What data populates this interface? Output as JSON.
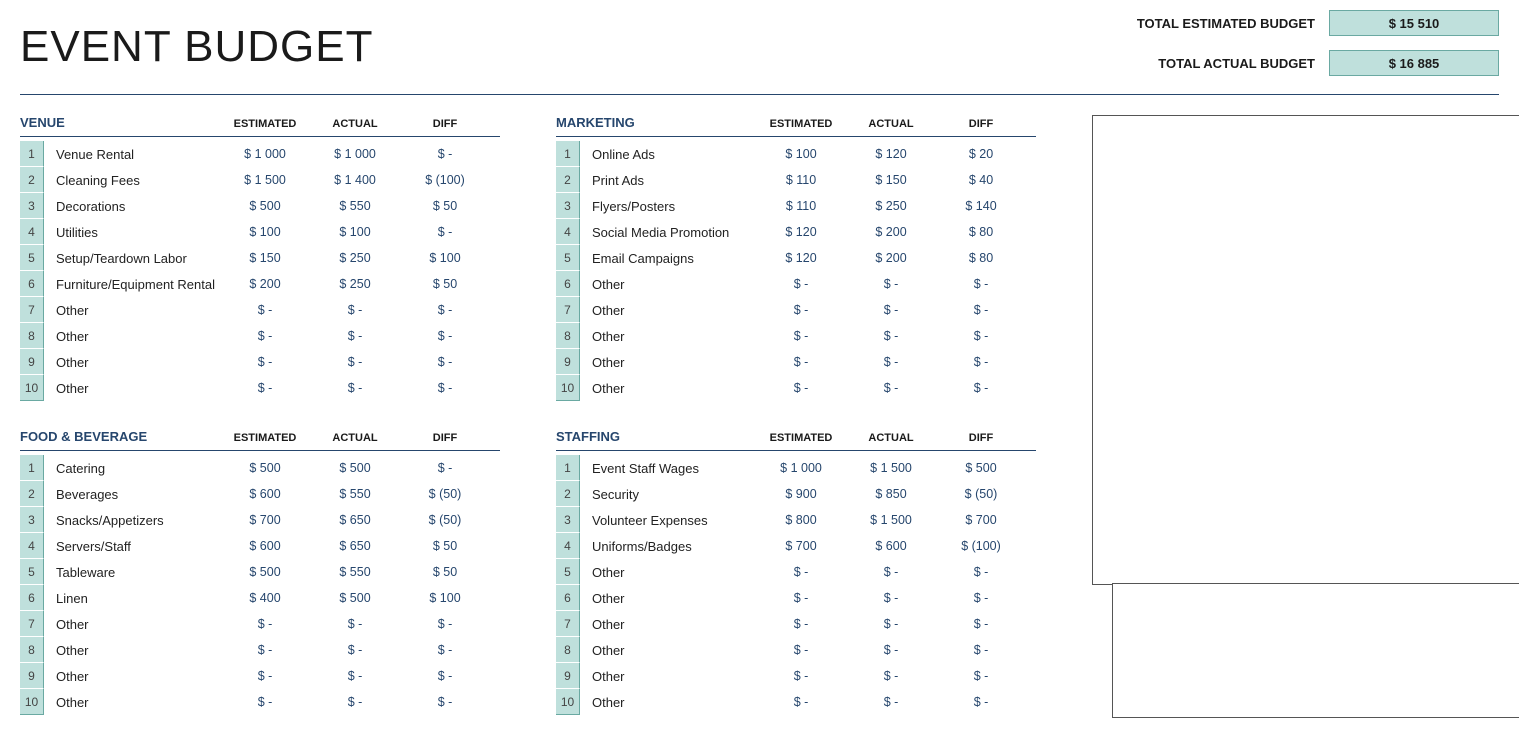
{
  "title": "EVENT BUDGET",
  "totals": {
    "estimated_label": "TOTAL ESTIMATED BUDGET",
    "estimated_value": "$ 15 510",
    "actual_label": "TOTAL ACTUAL BUDGET",
    "actual_value": "$ 16 885"
  },
  "columns": {
    "est": "ESTIMATED",
    "act": "ACTUAL",
    "diff": "DIFF"
  },
  "sections": [
    {
      "title": "VENUE",
      "rows": [
        {
          "n": "1",
          "label": "Venue Rental",
          "est": "$ 1 000",
          "act": "$ 1 000",
          "diff": "$ -"
        },
        {
          "n": "2",
          "label": "Cleaning Fees",
          "est": "$ 1 500",
          "act": "$ 1 400",
          "diff": "$ (100)"
        },
        {
          "n": "3",
          "label": "Decorations",
          "est": "$ 500",
          "act": "$ 550",
          "diff": "$ 50"
        },
        {
          "n": "4",
          "label": "Utilities",
          "est": "$ 100",
          "act": "$ 100",
          "diff": "$ -"
        },
        {
          "n": "5",
          "label": "Setup/Teardown Labor",
          "est": "$ 150",
          "act": "$ 250",
          "diff": "$ 100"
        },
        {
          "n": "6",
          "label": "Furniture/Equipment Rental",
          "est": "$ 200",
          "act": "$ 250",
          "diff": "$ 50"
        },
        {
          "n": "7",
          "label": "Other",
          "est": "$ -",
          "act": "$ -",
          "diff": "$ -"
        },
        {
          "n": "8",
          "label": "Other",
          "est": "$ -",
          "act": "$ -",
          "diff": "$ -"
        },
        {
          "n": "9",
          "label": "Other",
          "est": "$ -",
          "act": "$ -",
          "diff": "$ -"
        },
        {
          "n": "10",
          "label": "Other",
          "est": "$ -",
          "act": "$ -",
          "diff": "$ -"
        }
      ]
    },
    {
      "title": "MARKETING",
      "rows": [
        {
          "n": "1",
          "label": "Online Ads",
          "est": "$ 100",
          "act": "$ 120",
          "diff": "$ 20"
        },
        {
          "n": "2",
          "label": "Print Ads",
          "est": "$ 110",
          "act": "$ 150",
          "diff": "$ 40"
        },
        {
          "n": "3",
          "label": "Flyers/Posters",
          "est": "$ 110",
          "act": "$ 250",
          "diff": "$ 140"
        },
        {
          "n": "4",
          "label": "Social Media Promotion",
          "est": "$ 120",
          "act": "$ 200",
          "diff": "$ 80"
        },
        {
          "n": "5",
          "label": "Email Campaigns",
          "est": "$ 120",
          "act": "$ 200",
          "diff": "$ 80"
        },
        {
          "n": "6",
          "label": "Other",
          "est": "$ -",
          "act": "$ -",
          "diff": "$ -"
        },
        {
          "n": "7",
          "label": "Other",
          "est": "$ -",
          "act": "$ -",
          "diff": "$ -"
        },
        {
          "n": "8",
          "label": "Other",
          "est": "$ -",
          "act": "$ -",
          "diff": "$ -"
        },
        {
          "n": "9",
          "label": "Other",
          "est": "$ -",
          "act": "$ -",
          "diff": "$ -"
        },
        {
          "n": "10",
          "label": "Other",
          "est": "$ -",
          "act": "$ -",
          "diff": "$ -"
        }
      ]
    },
    {
      "title": "FOOD & BEVERAGE",
      "rows": [
        {
          "n": "1",
          "label": "Catering",
          "est": "$ 500",
          "act": "$ 500",
          "diff": "$ -"
        },
        {
          "n": "2",
          "label": "Beverages",
          "est": "$ 600",
          "act": "$ 550",
          "diff": "$ (50)"
        },
        {
          "n": "3",
          "label": "Snacks/Appetizers",
          "est": "$ 700",
          "act": "$ 650",
          "diff": "$ (50)"
        },
        {
          "n": "4",
          "label": "Servers/Staff",
          "est": "$ 600",
          "act": "$ 650",
          "diff": "$ 50"
        },
        {
          "n": "5",
          "label": "Tableware",
          "est": "$ 500",
          "act": "$ 550",
          "diff": "$ 50"
        },
        {
          "n": "6",
          "label": "Linen",
          "est": "$ 400",
          "act": "$ 500",
          "diff": "$ 100"
        },
        {
          "n": "7",
          "label": "Other",
          "est": "$ -",
          "act": "$ -",
          "diff": "$ -"
        },
        {
          "n": "8",
          "label": "Other",
          "est": "$ -",
          "act": "$ -",
          "diff": "$ -"
        },
        {
          "n": "9",
          "label": "Other",
          "est": "$ -",
          "act": "$ -",
          "diff": "$ -"
        },
        {
          "n": "10",
          "label": "Other",
          "est": "$ -",
          "act": "$ -",
          "diff": "$ -"
        }
      ]
    },
    {
      "title": "STAFFING",
      "rows": [
        {
          "n": "1",
          "label": "Event Staff Wages",
          "est": "$ 1 000",
          "act": "$ 1 500",
          "diff": "$ 500"
        },
        {
          "n": "2",
          "label": "Security",
          "est": "$ 900",
          "act": "$ 850",
          "diff": "$ (50)"
        },
        {
          "n": "3",
          "label": "Volunteer Expenses",
          "est": "$ 800",
          "act": "$ 1 500",
          "diff": "$ 700"
        },
        {
          "n": "4",
          "label": "Uniforms/Badges",
          "est": "$ 700",
          "act": "$ 600",
          "diff": "$ (100)"
        },
        {
          "n": "5",
          "label": "Other",
          "est": "$ -",
          "act": "$ -",
          "diff": "$ -"
        },
        {
          "n": "6",
          "label": "Other",
          "est": "$ -",
          "act": "$ -",
          "diff": "$ -"
        },
        {
          "n": "7",
          "label": "Other",
          "est": "$ -",
          "act": "$ -",
          "diff": "$ -"
        },
        {
          "n": "8",
          "label": "Other",
          "est": "$ -",
          "act": "$ -",
          "diff": "$ -"
        },
        {
          "n": "9",
          "label": "Other",
          "est": "$ -",
          "act": "$ -",
          "diff": "$ -"
        },
        {
          "n": "10",
          "label": "Other",
          "est": "$ -",
          "act": "$ -",
          "diff": "$ -"
        }
      ]
    }
  ]
}
